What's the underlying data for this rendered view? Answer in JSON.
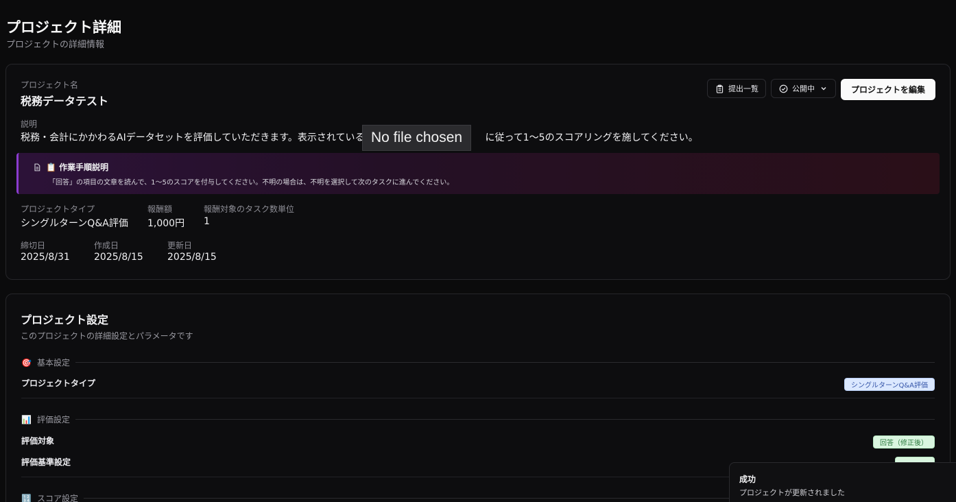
{
  "header": {
    "title": "プロジェクト詳細",
    "subtitle": "プロジェクトの詳細情報"
  },
  "project": {
    "name_label": "プロジェクト名",
    "name": "税務データテスト",
    "description_label": "説明",
    "description_before": "税務・会計にかかわるAIデータセットを評価していただきます。表示されている",
    "description_after": "に従って1〜5のスコアリングを施してください。",
    "type_label": "プロジェクトタイプ",
    "type": "シングルターンQ&A評価",
    "reward_label": "報酬額",
    "reward": "1,000円",
    "reward_unit_label": "報酬対象のタスク数単位",
    "reward_unit": "1",
    "deadline_label": "締切日",
    "deadline": "2025/8/31",
    "created_label": "作成日",
    "created": "2025/8/15",
    "updated_label": "更新日",
    "updated": "2025/8/15"
  },
  "actions": {
    "submissions": "提出一覧",
    "status": "公開中",
    "edit": "プロジェクトを編集"
  },
  "file_input": {
    "tooltip": "No file chosen"
  },
  "instructions": {
    "title": "📋 作業手順説明",
    "body": "「回答」の項目の文章を読んで、1〜5のスコアを付与してください。不明の場合は、不明を選択して次のタスクに進んでください。"
  },
  "settings": {
    "title": "プロジェクト設定",
    "subtitle": "このプロジェクトの詳細設定とパラメータです",
    "basic": {
      "heading": "基本設定",
      "icon": "🎯",
      "project_type_label": "プロジェクトタイプ",
      "project_type_value": "シングルターンQ&A評価"
    },
    "evaluation": {
      "heading": "評価設定",
      "icon": "📊",
      "target_label": "評価対象",
      "target_value": "回答（修正後）",
      "criteria_label": "評価基準設定"
    },
    "score": {
      "heading": "スコア設定",
      "icon": "🔢"
    }
  },
  "toast": {
    "title": "成功",
    "description": "プロジェクトが更新されました"
  },
  "colors": {
    "background": "#0b0b0c",
    "card": "#0d0d0f",
    "accent_purple": "#8a3ccf",
    "badge_blue": "#dbe8ff",
    "badge_green": "#d9f5df"
  }
}
